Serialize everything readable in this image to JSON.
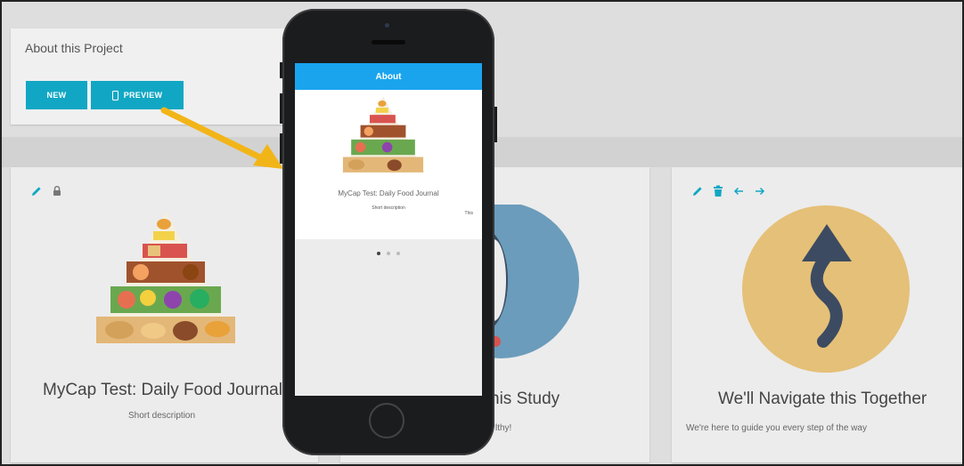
{
  "about_panel": {
    "title": "About this Project",
    "new_label": "NEW",
    "preview_label": "PREVIEW"
  },
  "cards": [
    {
      "title": "MyCap Test: Daily Food Journal",
      "description": "Short description",
      "tools": [
        "pencil-icon",
        "lock-icon"
      ],
      "image": "food-pyramid"
    },
    {
      "title": "his Study",
      "description": "lthy!",
      "tools": [],
      "image": "blue-circle"
    },
    {
      "title": "We'll Navigate this Together",
      "description": "We're here to guide you every step of the way",
      "tools": [
        "pencil-icon",
        "trash-icon",
        "arrow-left-icon",
        "arrow-right-icon"
      ],
      "image": "winding-arrow"
    }
  ],
  "phone_preview": {
    "header": "About",
    "card_title": "MyCap Test: Daily Food Journal",
    "card_description": "Short description",
    "card_extra": "This",
    "page_count": 3,
    "active_page": 1
  },
  "colors": {
    "accent": "#11a7c4",
    "phone_header": "#1aa4ee",
    "arrow": "#f2b518",
    "badge_circle": "#e5c078",
    "badge_arrow": "#3c4b61",
    "blue_circle": "#6b9cbb"
  }
}
